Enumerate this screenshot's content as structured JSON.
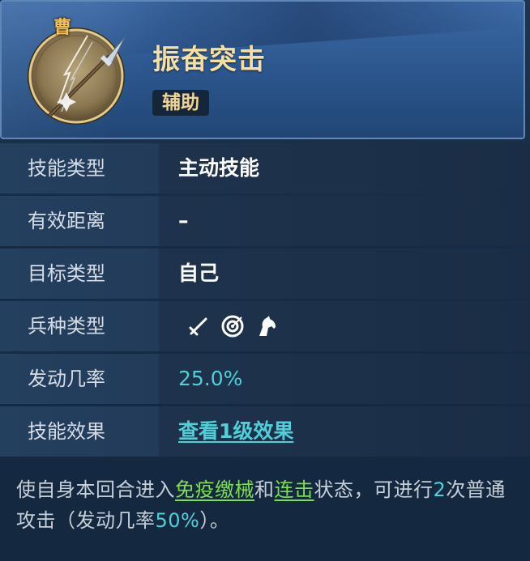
{
  "skill": {
    "faction_char": "曹",
    "name": "振奋突击",
    "tag": "辅助",
    "icon": "spear-emblem-icon"
  },
  "rows": [
    {
      "label": "技能类型",
      "value": "主动技能"
    },
    {
      "label": "有效距离",
      "value": "–"
    },
    {
      "label": "目标类型",
      "value": "自己"
    },
    {
      "label": "兵种类型",
      "icons": [
        "sword-icon",
        "archery-target-icon",
        "horse-head-icon"
      ]
    },
    {
      "label": "发动几率",
      "value": "25.0%"
    },
    {
      "label": "技能效果",
      "value": "查看1级效果"
    }
  ],
  "description": {
    "part1": "使自身本回合进入",
    "keyword1": "免疫缴械",
    "part2": "和",
    "keyword2": "连击",
    "part3": "状态，可进行",
    "num1": "2",
    "part4": "次普通攻击（发动几率",
    "num2": "50%",
    "part5": "）。"
  },
  "colors": {
    "title": "#f6dfa2",
    "accent_cyan": "#4fd0d8",
    "keyword_green": "#7ddf4a",
    "faction_gold": "#f2c15a"
  }
}
